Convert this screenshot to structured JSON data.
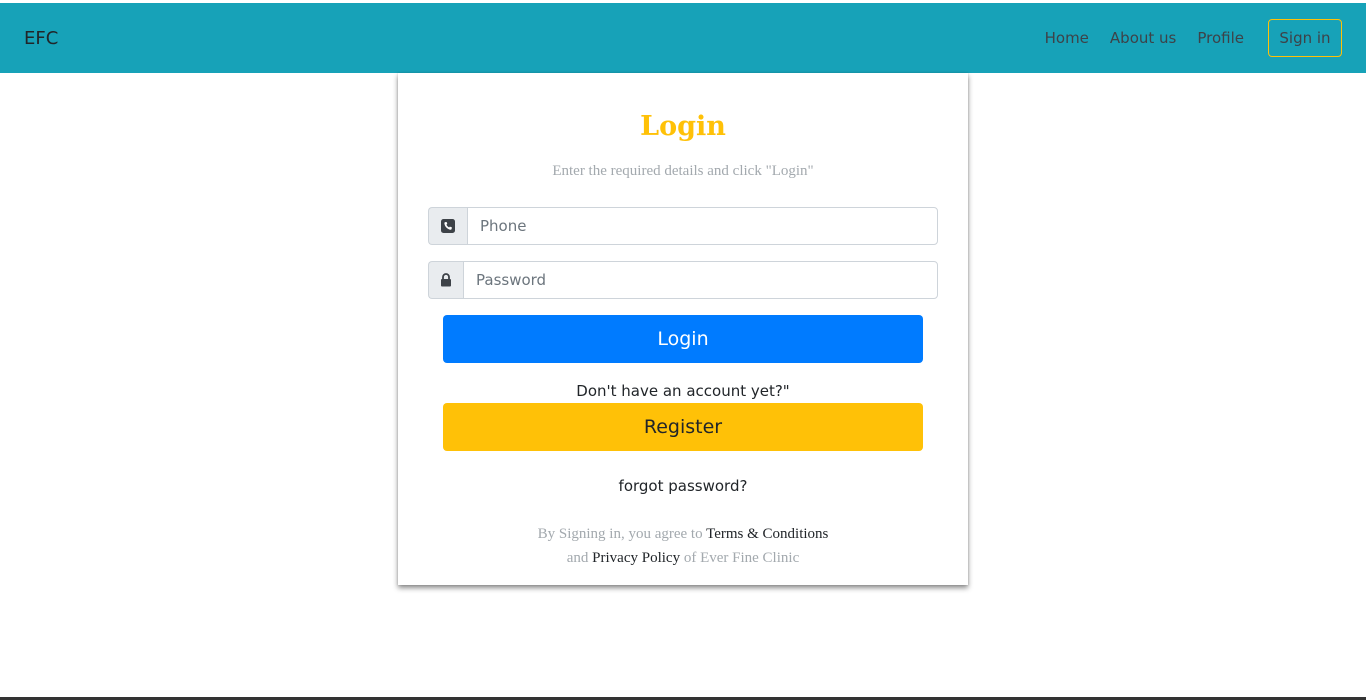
{
  "navbar": {
    "brand": "EFC",
    "links": [
      "Home",
      "About us",
      "Profile"
    ],
    "signin_label": "Sign in",
    "background": "#17a2b8",
    "signin_border": "#ffc107"
  },
  "login": {
    "title": "Login",
    "subtitle": "Enter the required details and click \"Login\"",
    "phone_placeholder": "Phone",
    "phone_icon": "phone-icon",
    "password_placeholder": "Password",
    "password_icon": "lock-icon",
    "login_button": "Login",
    "no_account_text": "Don't have an account yet?\"",
    "register_button": "Register",
    "forgot_link": "forgot password?",
    "terms_prefix": "By Signing in, you agree to",
    "terms_link": "Terms & Conditions",
    "terms_and": "and",
    "privacy_link": "Privacy Policy",
    "terms_suffix": "of Ever Fine Clinic",
    "title_color": "#ffc107",
    "login_color": "#007bff",
    "register_color": "#ffc107"
  }
}
